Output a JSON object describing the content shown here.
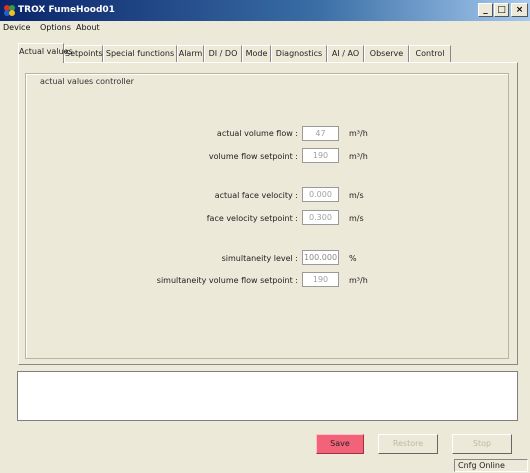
{
  "window": {
    "title": "TROX FumeHood01",
    "controls": {
      "minimize": "_",
      "maximize": "□",
      "close": "×"
    }
  },
  "menubar": {
    "items": [
      "Device",
      "Options",
      "About"
    ]
  },
  "tabs": [
    {
      "label": "Actual values",
      "active": true
    },
    {
      "label": "Setpoints"
    },
    {
      "label": "Special functions"
    },
    {
      "label": "Alarm"
    },
    {
      "label": "DI / DO"
    },
    {
      "label": "Mode"
    },
    {
      "label": "Diagnostics"
    },
    {
      "label": "AI / AO"
    },
    {
      "label": "Observe"
    },
    {
      "label": "Control"
    }
  ],
  "panel": {
    "group_title": "actual values controller",
    "fields": [
      {
        "label": "actual volume flow :",
        "value": "47",
        "unit": "m³/h"
      },
      {
        "label": "volume flow setpoint :",
        "value": "190",
        "unit": "m³/h"
      },
      {
        "label": "actual face velocity :",
        "value": "0.000",
        "unit": "m/s"
      },
      {
        "label": "face velocity setpoint :",
        "value": "0.300",
        "unit": "m/s"
      },
      {
        "label": "simultaneity level :",
        "value": "100.000",
        "unit": "%"
      },
      {
        "label": "simultaneity volume flow setpoint :",
        "value": "190",
        "unit": "m³/h"
      }
    ]
  },
  "buttons": {
    "save": "Save",
    "second": "Restore",
    "third": "Stop"
  },
  "statusbar": {
    "status": "Cnfg Online"
  },
  "colors": {
    "save_button": "#f2637a",
    "title_bar": "#0a246a"
  }
}
